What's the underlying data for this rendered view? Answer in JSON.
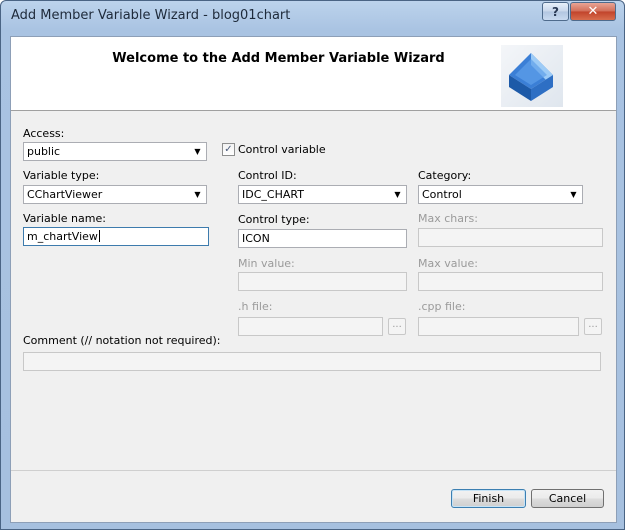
{
  "window": {
    "title": "Add Member Variable Wizard - blog01chart",
    "help_label": "?",
    "close_label": "✕"
  },
  "header": {
    "title": "Welcome to the Add Member Variable Wizard",
    "graphic_icon": "wizard-cube-icon"
  },
  "access": {
    "label": "Access:",
    "value": "public"
  },
  "control_variable": {
    "label": "Control variable",
    "checked": true
  },
  "variable_type": {
    "label": "Variable type:",
    "value": "CChartViewer"
  },
  "variable_name": {
    "label": "Variable name:",
    "value": "m_chartView"
  },
  "control_id": {
    "label": "Control ID:",
    "value": "IDC_CHART"
  },
  "category": {
    "label": "Category:",
    "value": "Control"
  },
  "control_type": {
    "label": "Control type:",
    "value": "ICON"
  },
  "max_chars": {
    "label": "Max chars:",
    "value": ""
  },
  "min_value": {
    "label": "Min value:",
    "value": ""
  },
  "max_value": {
    "label": "Max value:",
    "value": ""
  },
  "h_file": {
    "label": ".h file:",
    "value": "",
    "browse_label": "..."
  },
  "cpp_file": {
    "label": ".cpp file:",
    "value": "",
    "browse_label": "..."
  },
  "comment": {
    "label": "Comment (// notation not required):",
    "value": ""
  },
  "buttons": {
    "finish": "Finish",
    "cancel": "Cancel"
  },
  "colors": {
    "title_bar": "#a9c3e2",
    "close_button": "#c1432a",
    "client": "#f0f0f0"
  }
}
